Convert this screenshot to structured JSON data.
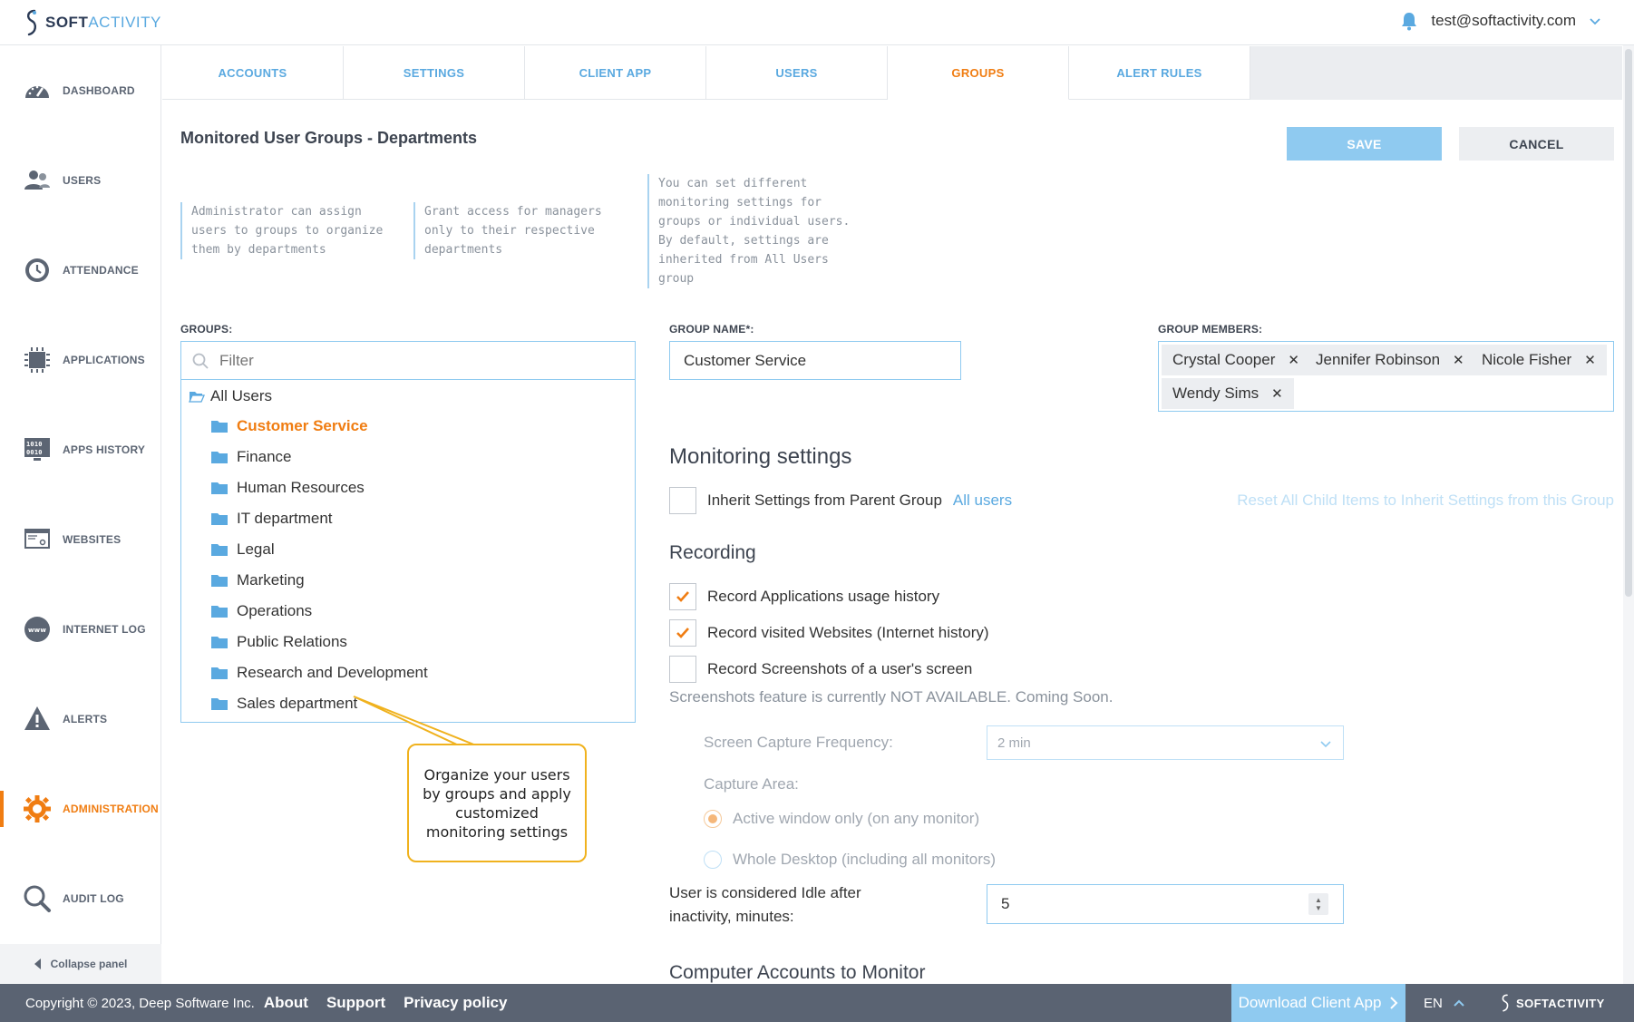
{
  "app": {
    "brand_soft": "SOFT",
    "brand_activity": "ACTIVITY",
    "user_email": "test@softactivity.com"
  },
  "sidebar": {
    "items": [
      {
        "label": "DASHBOARD",
        "icon": "dashboard-icon"
      },
      {
        "label": "USERS",
        "icon": "users-icon"
      },
      {
        "label": "ATTENDANCE",
        "icon": "attendance-icon"
      },
      {
        "label": "APPLICATIONS",
        "icon": "applications-icon"
      },
      {
        "label": "APPS HISTORY",
        "icon": "apps-history-icon"
      },
      {
        "label": "WEBSITES",
        "icon": "websites-icon"
      },
      {
        "label": "INTERNET LOG",
        "icon": "internet-log-icon"
      },
      {
        "label": "ALERTS",
        "icon": "alerts-icon"
      },
      {
        "label": "ADMINISTRATION",
        "icon": "administration-icon",
        "active": true
      },
      {
        "label": "AUDIT LOG",
        "icon": "audit-log-icon"
      }
    ],
    "collapse_label": "Collapse panel"
  },
  "tabs": [
    {
      "label": "ACCOUNTS"
    },
    {
      "label": "SETTINGS"
    },
    {
      "label": "CLIENT APP"
    },
    {
      "label": "USERS"
    },
    {
      "label": "GROUPS",
      "active": true
    },
    {
      "label": "ALERT RULES"
    }
  ],
  "main": {
    "title": "Monitored User Groups - Departments",
    "save_label": "SAVE",
    "cancel_label": "CANCEL",
    "hints": [
      "Administrator can assign\nusers to groups to organize\nthem by departments",
      "Grant access for managers\nonly to their respective\ndepartments",
      "You can set different\nmonitoring settings for\ngroups or individual users.\nBy default, settings are\ninherited from All Users\ngroup"
    ]
  },
  "groups": {
    "label": "GROUPS:",
    "filter_placeholder": "Filter",
    "root": "All Users",
    "items": [
      {
        "label": "Customer Service",
        "selected": true
      },
      {
        "label": "Finance"
      },
      {
        "label": "Human Resources"
      },
      {
        "label": "IT department"
      },
      {
        "label": "Legal"
      },
      {
        "label": "Marketing"
      },
      {
        "label": "Operations"
      },
      {
        "label": "Public Relations"
      },
      {
        "label": "Research and Development"
      },
      {
        "label": "Sales department"
      }
    ]
  },
  "group_name": {
    "label": "GROUP NAME*:",
    "value": "Customer Service"
  },
  "members": {
    "label": "GROUP MEMBERS:",
    "chips": [
      "Crystal Cooper",
      "Jennifer Robinson",
      "Nicole Fisher",
      "Wendy Sims"
    ]
  },
  "monitoring": {
    "heading": "Monitoring settings",
    "inherit_label": "Inherit Settings from Parent Group",
    "inherit_link": "All users",
    "inherit_checked": false,
    "reset_link": "Reset All Child Items to Inherit Settings from this Group",
    "recording_heading": "Recording",
    "options": [
      {
        "label": "Record Applications usage history",
        "checked": true
      },
      {
        "label": "Record visited Websites (Internet history)",
        "checked": true
      },
      {
        "label": "Record Screenshots of a user's screen",
        "checked": false
      }
    ],
    "screenshot_note": "Screenshots feature is currently NOT AVAILABLE. Coming Soon.",
    "capture_freq_label": "Screen Capture Frequency:",
    "capture_freq_value": "2 min",
    "capture_area_label": "Capture Area:",
    "capture_area_options": [
      {
        "label": "Active window only (on any monitor)",
        "selected": true
      },
      {
        "label": "Whole Desktop (including all monitors)",
        "selected": false
      }
    ],
    "idle_label": "User is considered Idle after inactivity, minutes:",
    "idle_value": "5",
    "computer_accounts_heading": "Computer Accounts to Monitor"
  },
  "callout": {
    "text": "Organize your users by groups and apply customized monitoring settings"
  },
  "footer": {
    "copyright": "Copyright © 2023, Deep Software Inc.",
    "links": [
      "About",
      "Support",
      "Privacy policy"
    ],
    "download_label": "Download Client App",
    "language": "EN",
    "brand": "SOFTACTIVITY"
  },
  "colors": {
    "accent_orange": "#f07d12",
    "accent_blue": "#5aa9e0",
    "footer_bg": "#5a6372",
    "save_bg": "#8fcaf0"
  }
}
